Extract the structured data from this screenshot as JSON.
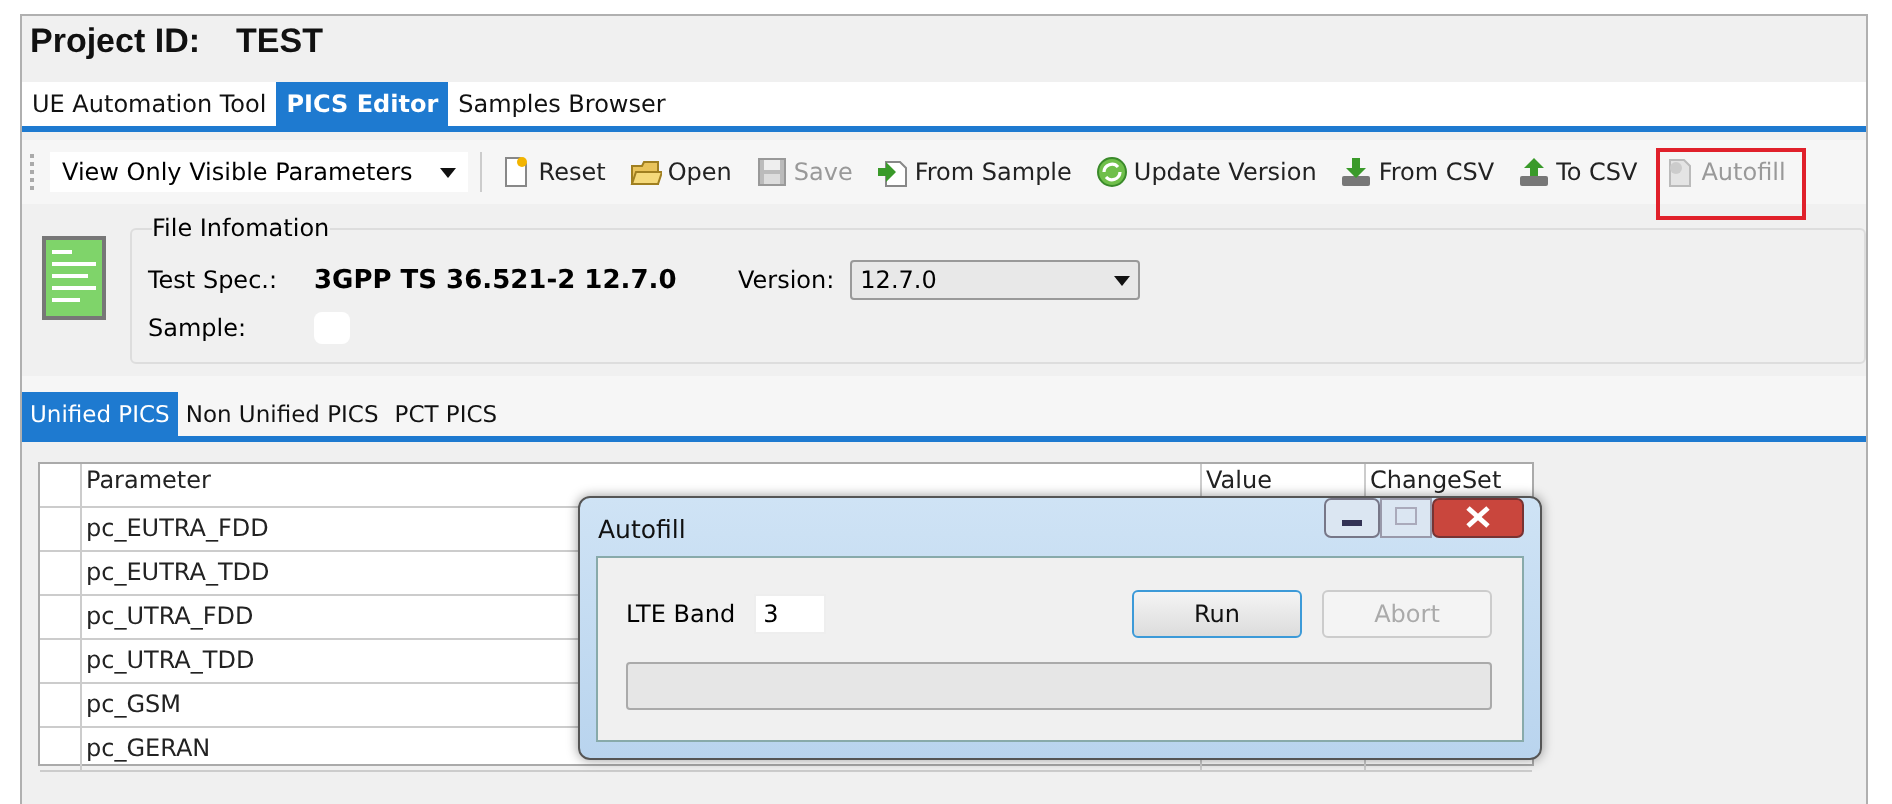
{
  "project": {
    "label": "Project ID:",
    "value": "TEST"
  },
  "tabs": [
    {
      "label": "UE Automation Tool",
      "selected": false
    },
    {
      "label": "PICS Editor",
      "selected": true
    },
    {
      "label": "Samples Browser",
      "selected": false
    }
  ],
  "toolbar": {
    "view_filter": "View Only Visible Parameters",
    "items": [
      {
        "kind": "reset",
        "label": "Reset",
        "disabled": false,
        "highlighted": false
      },
      {
        "kind": "open",
        "label": "Open",
        "disabled": false,
        "highlighted": false
      },
      {
        "kind": "save",
        "label": "Save",
        "disabled": true,
        "highlighted": false
      },
      {
        "kind": "from_sample",
        "label": "From Sample",
        "disabled": false,
        "highlighted": false
      },
      {
        "kind": "update",
        "label": "Update Version",
        "disabled": false,
        "highlighted": false
      },
      {
        "kind": "from_csv",
        "label": "From CSV",
        "disabled": false,
        "highlighted": false
      },
      {
        "kind": "to_csv",
        "label": "To CSV",
        "disabled": false,
        "highlighted": false
      },
      {
        "kind": "autofill",
        "label": "Autofill",
        "disabled": true,
        "highlighted": true
      }
    ]
  },
  "file_info": {
    "title": "File Infomation",
    "test_spec_label": "Test Spec.:",
    "test_spec": "3GPP TS 36.521-2 12.7.0",
    "version_label": "Version:",
    "version": "12.7.0",
    "sample_label": "Sample:"
  },
  "subtabs": [
    {
      "label": "Unified PICS",
      "selected": true
    },
    {
      "label": "Non Unified PICS",
      "selected": false
    },
    {
      "label": "PCT PICS",
      "selected": false
    }
  ],
  "table": {
    "columns": [
      "Parameter",
      "Value",
      "ChangeSet"
    ],
    "rows": [
      "pc_EUTRA_FDD",
      "pc_EUTRA_TDD",
      "pc_UTRA_FDD",
      "pc_UTRA_TDD",
      "pc_GSM",
      "pc_GERAN"
    ]
  },
  "dialog": {
    "title": "Autofill",
    "band_label": "LTE Band",
    "band": "3",
    "buttons": [
      {
        "label": "Run",
        "disabled": false
      },
      {
        "label": "Abort",
        "disabled": true
      }
    ],
    "progress": {
      "level": 0
    }
  }
}
